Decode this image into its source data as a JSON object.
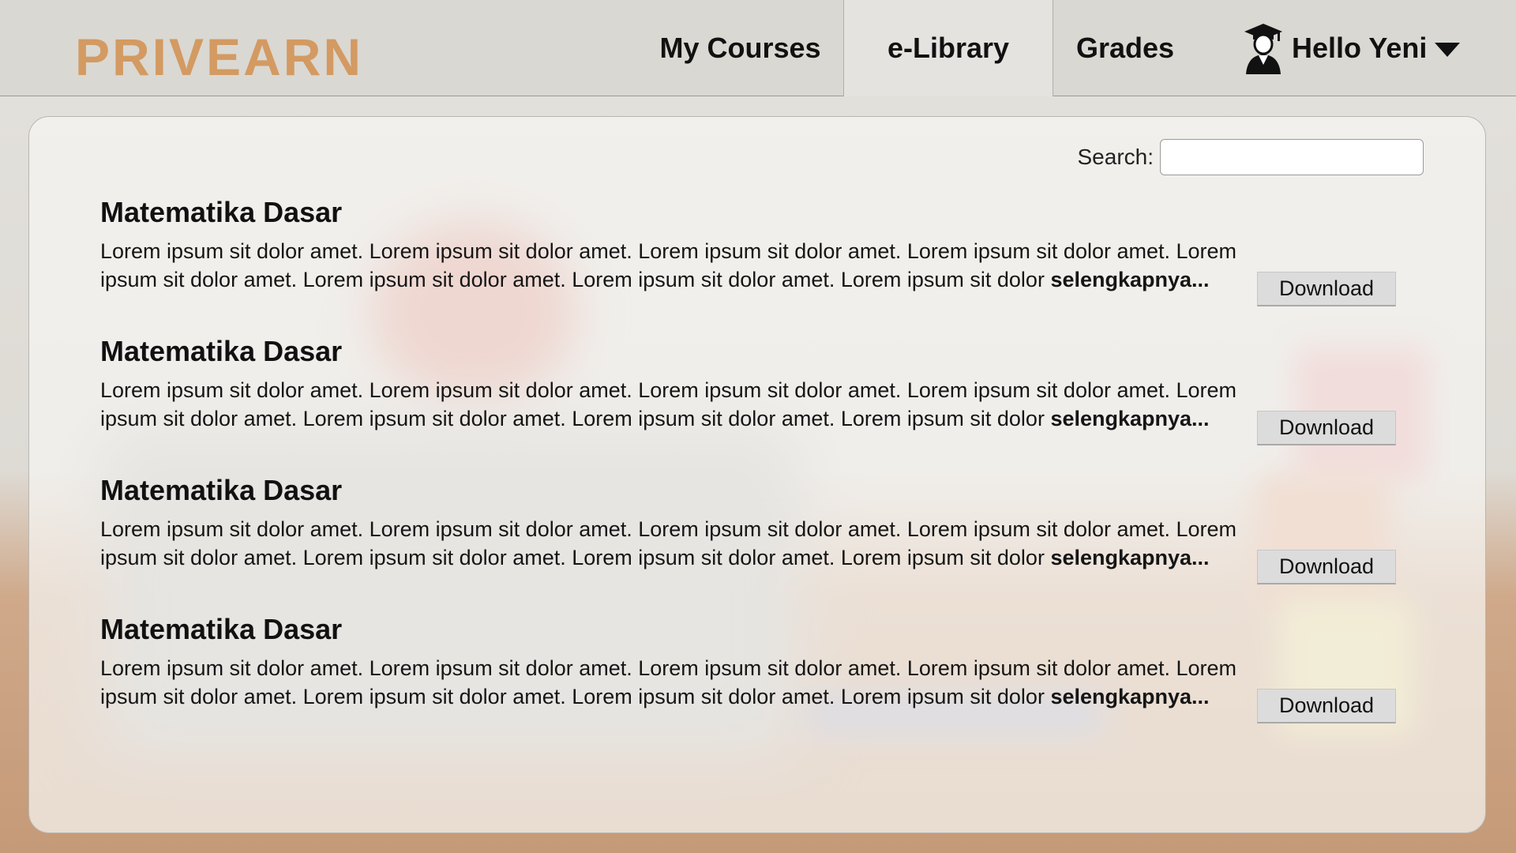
{
  "brand": {
    "logo": "PRIVEARN"
  },
  "nav": {
    "items": [
      {
        "label": "My Courses"
      },
      {
        "label": "e-Library",
        "active": true
      },
      {
        "label": "Grades"
      }
    ],
    "user": {
      "greeting": "Hello Yeni",
      "icon": "graduate-avatar-icon",
      "menu_icon": "caret-down-icon"
    }
  },
  "search": {
    "label": "Search:",
    "value": "",
    "placeholder": ""
  },
  "library": {
    "items": [
      {
        "title": "Matematika Dasar",
        "description": "Lorem ipsum sit dolor amet. Lorem ipsum sit dolor amet. Lorem ipsum sit dolor amet. Lorem ipsum sit dolor amet. Lorem ipsum sit dolor amet. Lorem ipsum sit dolor amet. Lorem ipsum sit dolor amet. Lorem ipsum sit dolor",
        "more_label": "selengkapnya...",
        "download_label": "Download"
      },
      {
        "title": "Matematika Dasar",
        "description": "Lorem ipsum sit dolor amet. Lorem ipsum sit dolor amet. Lorem ipsum sit dolor amet. Lorem ipsum sit dolor amet. Lorem ipsum sit dolor amet. Lorem ipsum sit dolor amet. Lorem ipsum sit dolor amet. Lorem ipsum sit dolor",
        "more_label": "selengkapnya...",
        "download_label": "Download"
      },
      {
        "title": "Matematika Dasar",
        "description": "Lorem ipsum sit dolor amet. Lorem ipsum sit dolor amet. Lorem ipsum sit dolor amet. Lorem ipsum sit dolor amet. Lorem ipsum sit dolor amet. Lorem ipsum sit dolor amet. Lorem ipsum sit dolor amet. Lorem ipsum sit dolor",
        "more_label": "selengkapnya...",
        "download_label": "Download"
      },
      {
        "title": "Matematika Dasar",
        "description": "Lorem ipsum sit dolor amet. Lorem ipsum sit dolor amet. Lorem ipsum sit dolor amet. Lorem ipsum sit dolor amet. Lorem ipsum sit dolor amet. Lorem ipsum sit dolor amet. Lorem ipsum sit dolor amet. Lorem ipsum sit dolor",
        "more_label": "selengkapnya...",
        "download_label": "Download"
      }
    ]
  },
  "colors": {
    "logo": "#d39a62",
    "active_tab": "#e4e3df",
    "button": "#dcdcdc"
  }
}
